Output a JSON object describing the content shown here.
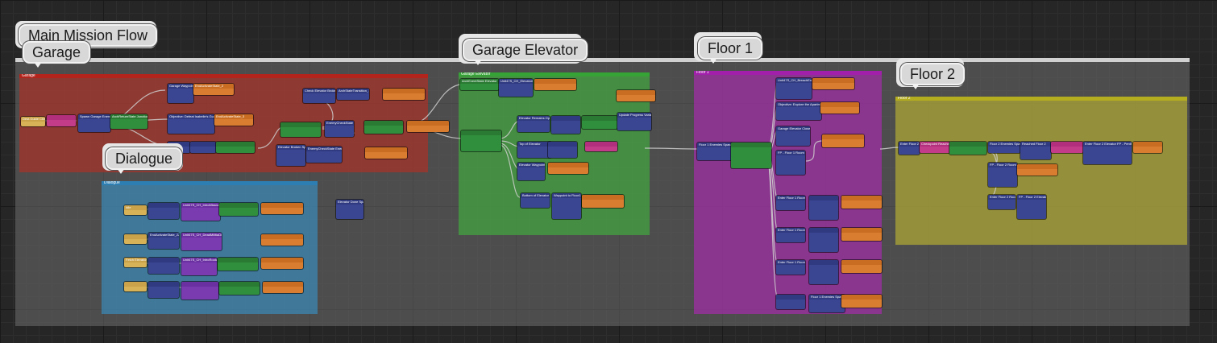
{
  "window": {
    "title": "Main Mission Flow"
  },
  "colors": {
    "background": "#262626",
    "outer_box": "#5a5a5a",
    "garage": "#a8332a",
    "dialogue": "#3a89b6",
    "garage_elevator": "#41a33f",
    "floor1": "#9b2fa0",
    "floor2": "#a8a235",
    "node_blue": "#3a4691",
    "node_orange": "#d97e31",
    "node_green": "#2f8f3c",
    "node_purple": "#7a3bb0",
    "node_pink": "#c23c8a",
    "node_yellow": "#d7b257"
  },
  "bubbles": {
    "main": "Main Mission Flow",
    "garage": "Garage",
    "dialogue": "Dialogue",
    "garage_elevator": "Garage Elevator",
    "floor1": "Floor 1",
    "floor2": "Floor 2"
  },
  "comment_titles": {
    "garage": "Garage",
    "dialogue": "Dialogue",
    "garage_elevator": "Garage Elevator",
    "floor1": "Floor 1",
    "floor2": "Floor 2"
  },
  "garage_nodes": [
    "Dest.Guide Check 75",
    "Spawn Garage Enemies",
    "ArchReturnState Junction_0",
    "Garage Waypoint",
    "Objective: Defeat Isabelle's Guards",
    "EndActivateState_2",
    "EndActivateState_3",
    "Check Elevator Broken",
    "ArchStateTransition_14",
    "EnemyCheckState Enemy Spawned",
    "Elevator Broken Spawn",
    "EnemyCheckState Enemy Spawned 4"
  ],
  "dialogue_nodes": [
    "Idle",
    "Unit47S_CH_IntroMissionStart",
    "EndActivateState_22",
    "Unit47S_CH_DeadMilitiaDialog",
    "Fetch Elevator",
    "Unit47S_CH_IntroRootA",
    "Elevator Done Spawn"
  ],
  "elevator_nodes": [
    "ArchEventState Elevator",
    "Unit47S_CH_ElevatorCheck",
    "Elevator Remains Open",
    "Top of Elevator",
    "Elevator Waypoint",
    "Bottom of Elevator",
    "Waypoint to Floor1",
    "Update Progress Variable"
  ],
  "floor1_nodes": [
    "Floor 1 Enemies Spawned",
    "Unit47S_CH_BreachEnemies",
    "Objective: Explore the Apartment",
    "Garage Elevator Closed",
    "FP - Floor 1 Room 1",
    "Enter Floor 1 Room 1",
    "Enter Floor 1 Room 2",
    "Enter Floor 1 Room 3",
    "Floor 1 Enemies Spawned"
  ],
  "floor2_nodes": [
    "Enter Floor 2",
    "Checkpoint Reached",
    "Floor 2 Enemies Spawned",
    "Reached Floor 2",
    "Enter Floor 2 Elevator FP - Penthouse",
    "FP - Floor 2 Room 1",
    "Enter Floor 2 Room 2",
    "FP - Floor 2 Elevator"
  ]
}
